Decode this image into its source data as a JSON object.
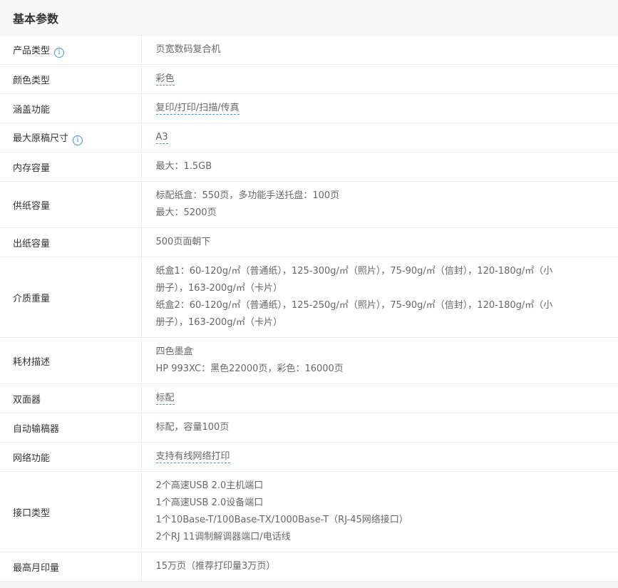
{
  "section": {
    "title": "基本参数"
  },
  "rows": [
    {
      "label": "产品类型",
      "info": true,
      "link": false,
      "value": [
        "页宽数码复合机"
      ]
    },
    {
      "label": "颜色类型",
      "info": false,
      "link": true,
      "value": [
        "彩色"
      ]
    },
    {
      "label": "涵盖功能",
      "info": false,
      "link": true,
      "value": [
        "复印/打印/扫描/传真"
      ]
    },
    {
      "label": "最大原稿尺寸",
      "info": true,
      "link": true,
      "value": [
        "A3"
      ]
    },
    {
      "label": "内存容量",
      "info": false,
      "link": false,
      "value": [
        "最大：1.5GB"
      ]
    },
    {
      "label": "供纸容量",
      "info": false,
      "link": false,
      "value": [
        "标配纸盒：550页，多功能手送托盘：100页",
        "最大：5200页"
      ]
    },
    {
      "label": "出纸容量",
      "info": false,
      "link": false,
      "value": [
        "500页面朝下"
      ]
    },
    {
      "label": "介质重量",
      "info": false,
      "link": false,
      "value": [
        "纸盒1：60-120g/㎡（普通纸），125-300g/㎡（照片），75-90g/㎡（信封），120-180g/㎡（小",
        "册子），163-200g/㎡（卡片）",
        "纸盒2：60-120g/㎡（普通纸），125-250g/㎡（照片），75-90g/㎡（信封），120-180g/㎡（小",
        "册子），163-200g/㎡（卡片）"
      ]
    },
    {
      "label": "耗材描述",
      "info": false,
      "link": false,
      "value": [
        "四色墨盒",
        "HP 993XC：黑色22000页，彩色：16000页"
      ]
    },
    {
      "label": "双面器",
      "info": false,
      "link": true,
      "value": [
        "标配"
      ]
    },
    {
      "label": "自动输稿器",
      "info": false,
      "link": false,
      "value": [
        "标配，容量100页"
      ]
    },
    {
      "label": "网络功能",
      "info": false,
      "link": true,
      "value": [
        "支持有线网络打印"
      ]
    },
    {
      "label": "接口类型",
      "info": false,
      "link": false,
      "value": [
        "2个高速USB 2.0主机端口",
        "1个高速USB 2.0设备端口",
        "1个10Base-T/100Base-TX/1000Base-T（RJ-45网络接口）",
        "2个RJ 11调制解调器端口/电话线"
      ]
    },
    {
      "label": "最高月印量",
      "info": false,
      "link": false,
      "value": [
        "15万页（推荐打印量3万页）"
      ]
    }
  ],
  "icons": {
    "info": "info-icon"
  },
  "colors": {
    "link": "#4a8fd6",
    "label": "#333333",
    "value": "#666666",
    "border": "#ececec"
  }
}
